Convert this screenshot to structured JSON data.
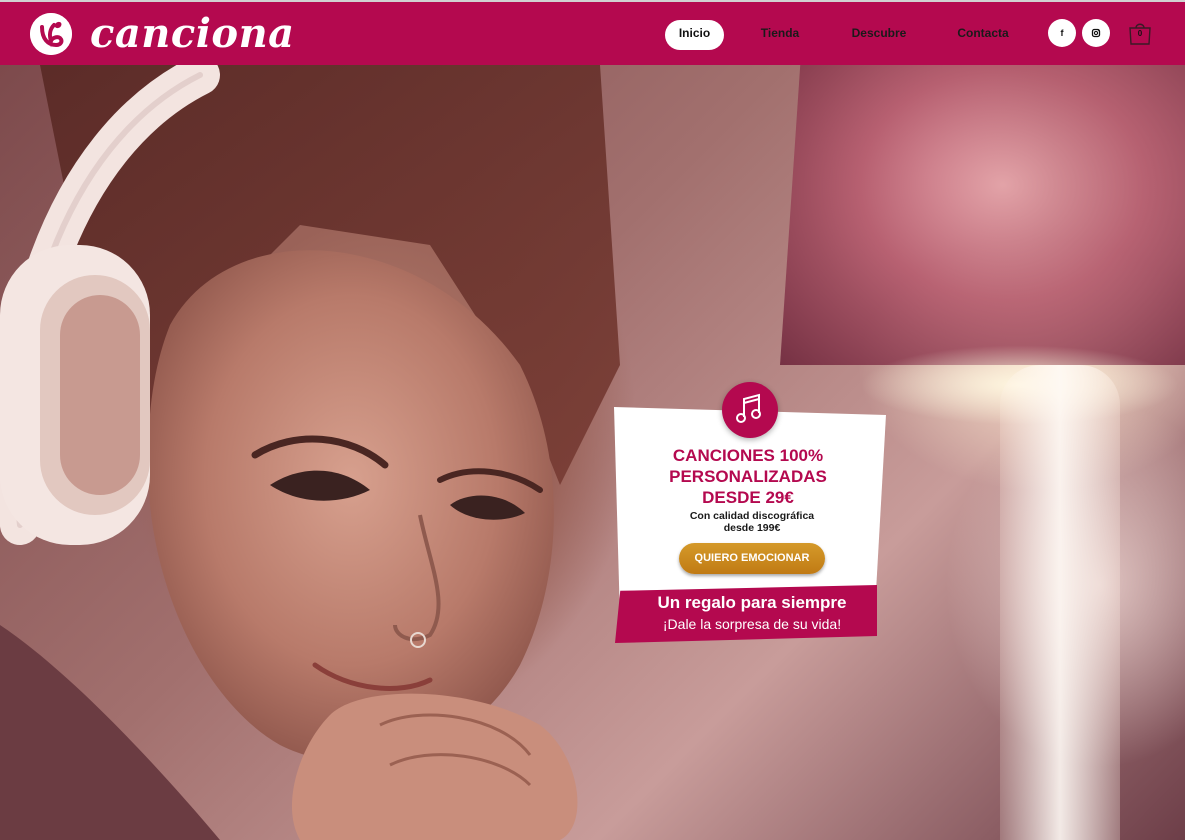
{
  "brand": {
    "name": "canciona",
    "color": "#b4094f"
  },
  "nav": {
    "items": [
      {
        "label": "Inicio",
        "active": true
      },
      {
        "label": "Tienda",
        "active": false
      },
      {
        "label": "Descubre",
        "active": false
      },
      {
        "label": "Contacta",
        "active": false
      }
    ]
  },
  "social": {
    "facebook_icon": "facebook-icon",
    "facebook_glyph": "f",
    "instagram_icon": "instagram-icon"
  },
  "cart": {
    "icon": "shopping-bag-icon",
    "count": "0"
  },
  "promo": {
    "icon": "music-note-icon",
    "title_line1": "CANCIONES 100%",
    "title_line2": "PERSONALIZADAS",
    "title_line3": "DESDE 29€",
    "subtitle_line1": "Con calidad discográfica",
    "subtitle_line2": "desde 199€",
    "cta_label": "QUIERO EMOCIONAR",
    "cta_color": "#c98518"
  },
  "tagline": {
    "main": "Un regalo para siempre",
    "sub": "¡Dale la sorpresa de su vida!"
  }
}
